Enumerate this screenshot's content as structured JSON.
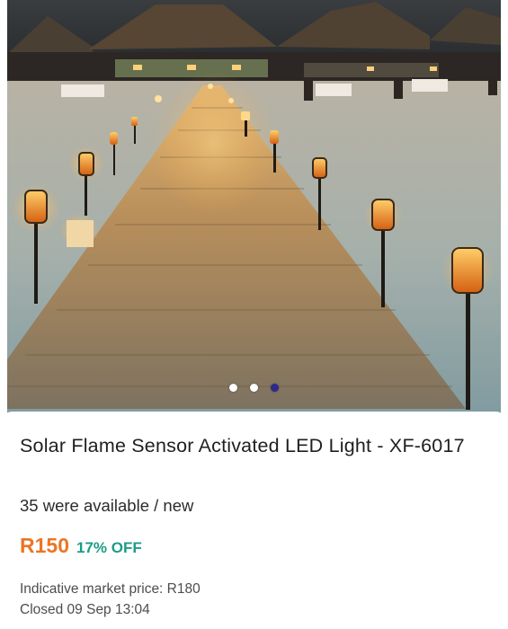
{
  "product": {
    "title": "Solar Flame Sensor Activated LED Light - XF-6017",
    "availability": "35 were available / new",
    "price": "R150",
    "discount": "17% OFF",
    "market_price": "Indicative market price: R180",
    "closed": "Closed 09 Sep 13:04"
  },
  "gallery": {
    "image_subject": "wooden-boardwalk-with-flame-torch-lights",
    "dot_count": 3,
    "active_index": 2
  },
  "colors": {
    "price": "#ec7523",
    "discount": "#1b9c86",
    "active_dot": "#2d2a8c",
    "inactive_dot": "#ffffff"
  }
}
